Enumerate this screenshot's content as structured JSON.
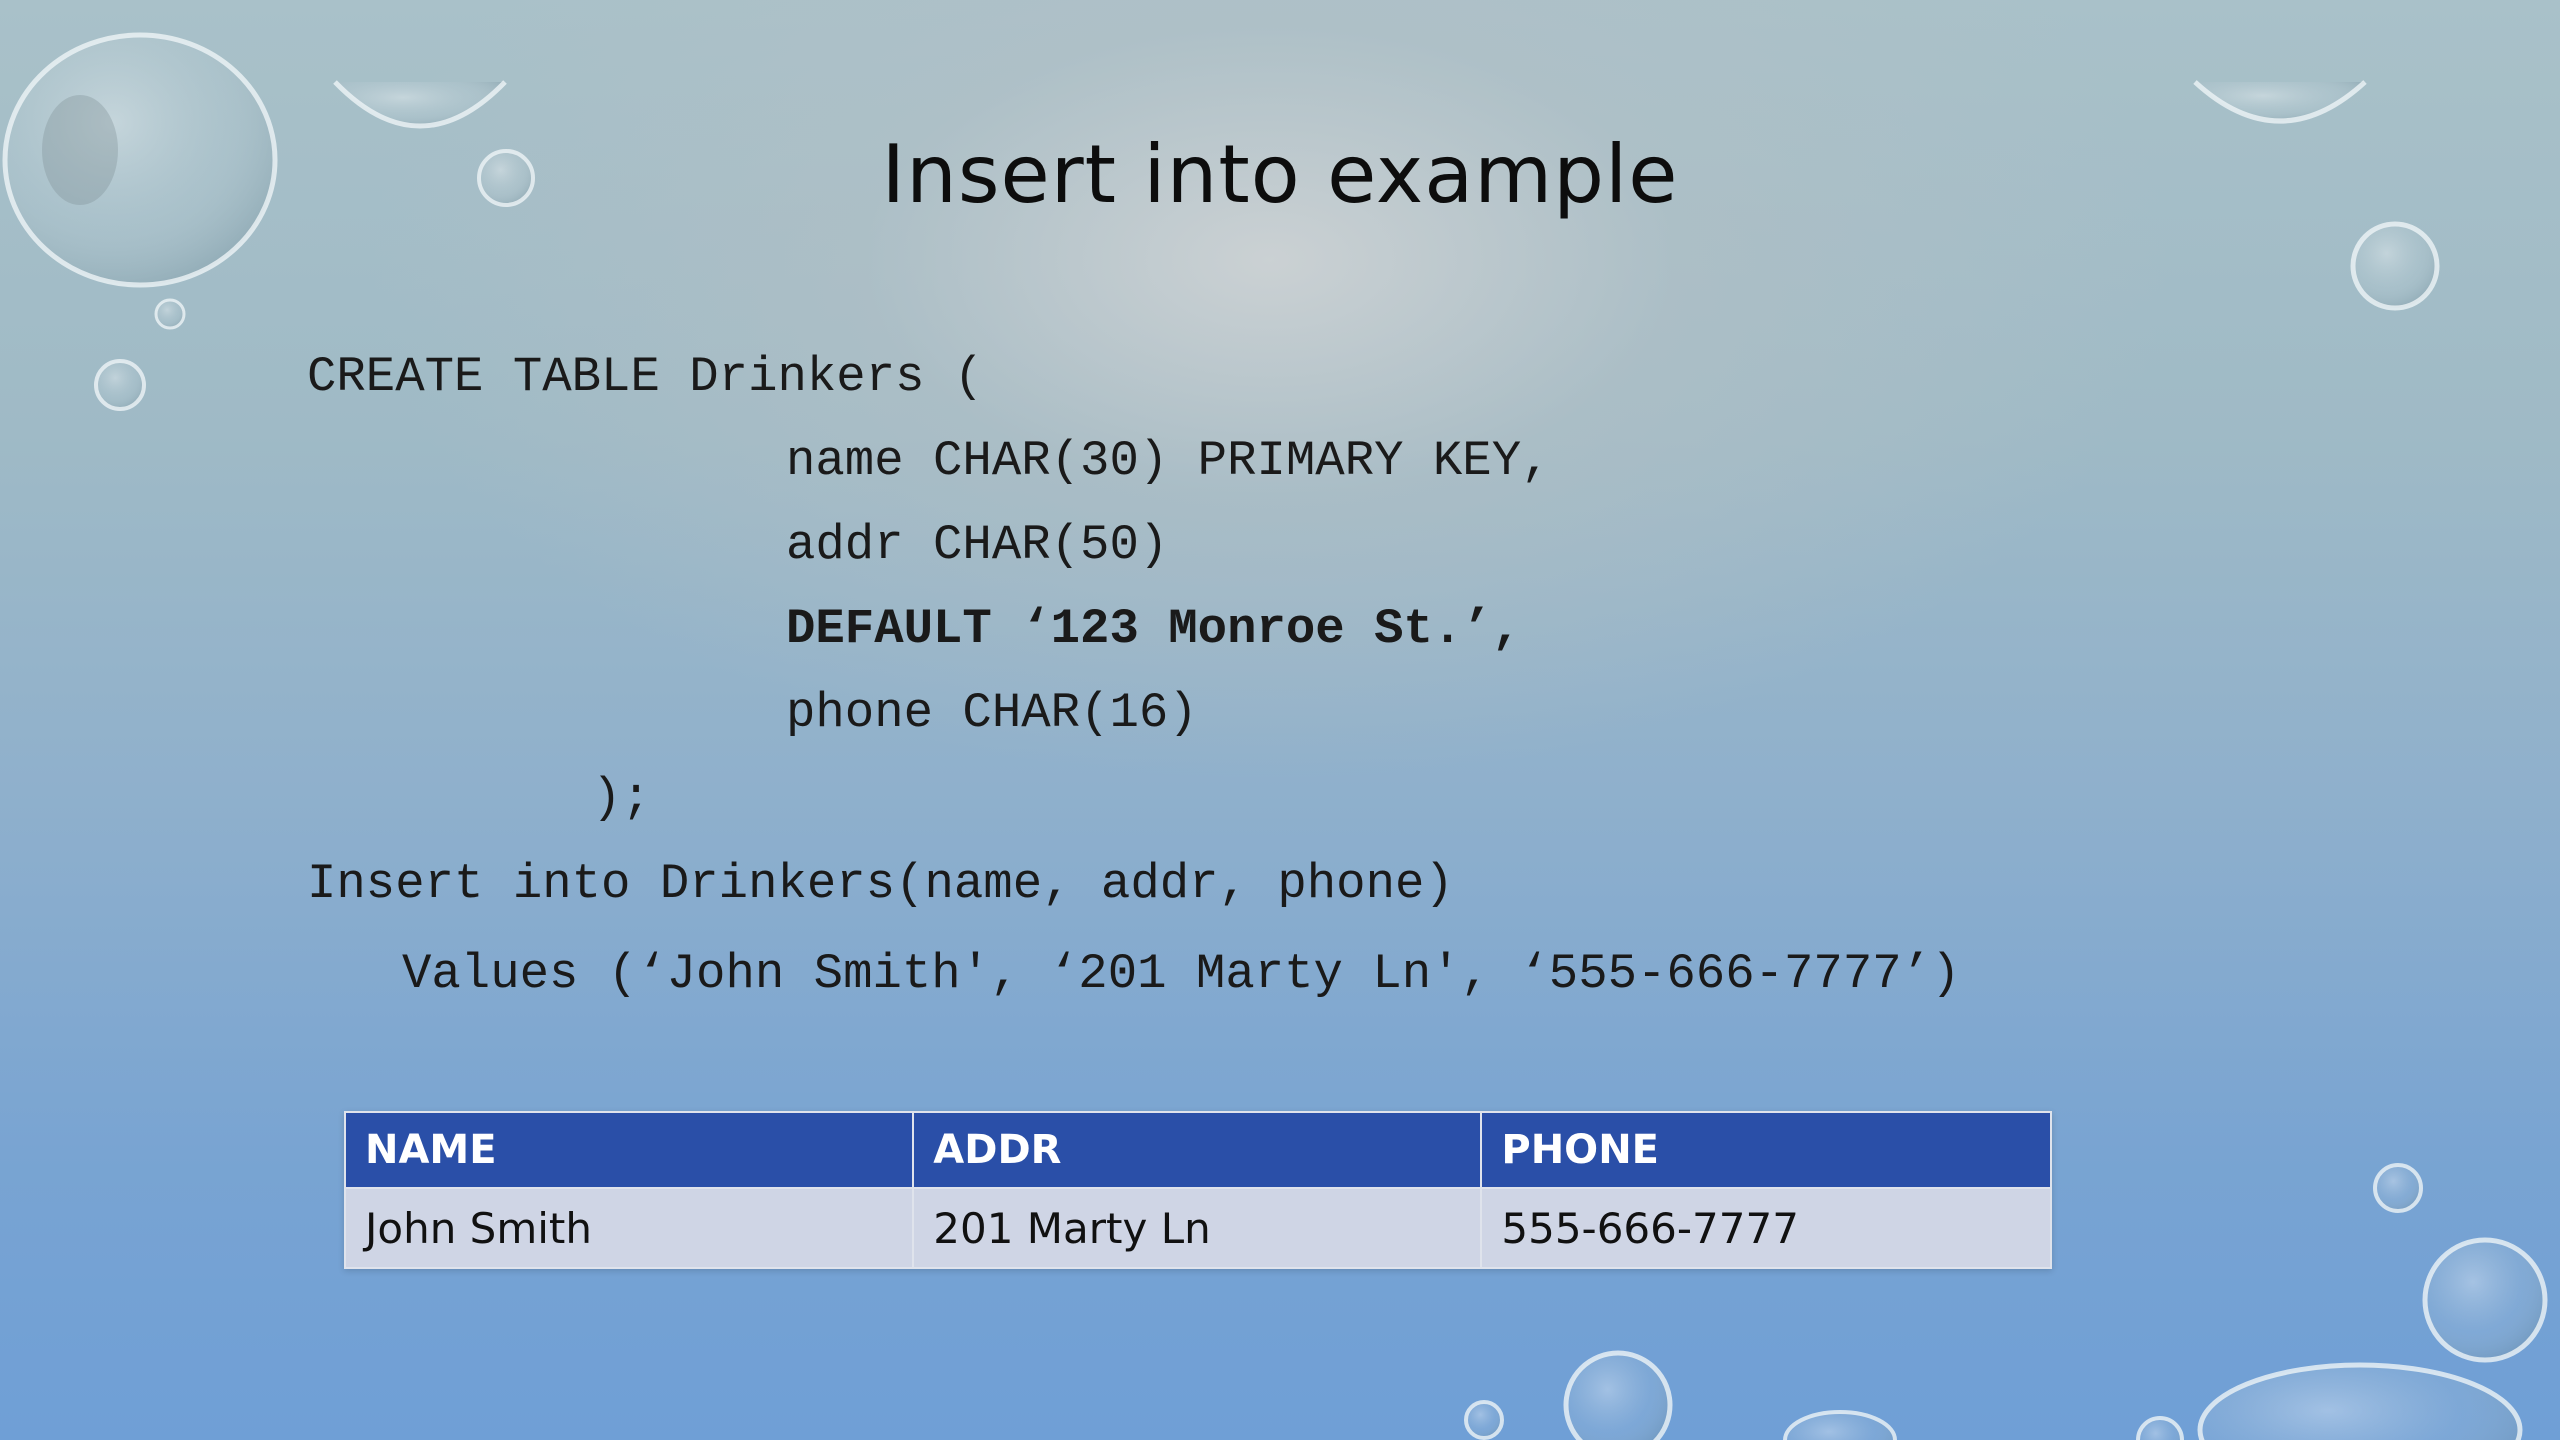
{
  "slide": {
    "title": "Insert into example",
    "code": {
      "line1": "CREATE TABLE Drinkers (",
      "line2": "name CHAR(30) PRIMARY KEY,",
      "line3": "addr CHAR(50)",
      "line4": "DEFAULT ‘123 Monroe St.’,",
      "line5": "phone CHAR(16)",
      "line6": ");",
      "line7": "Insert into Drinkers(name, addr, phone)",
      "line8": "Values (‘John Smith', ‘201 Marty Ln', ‘555-666-7777’)"
    },
    "table": {
      "headers": [
        "NAME",
        "ADDR",
        "PHONE"
      ],
      "rows": [
        [
          "John Smith",
          "201 Marty Ln",
          "555-666-7777"
        ]
      ]
    }
  },
  "colors": {
    "table_header_bg": "#2a4fa8",
    "table_row_bg": "#cfd5e5",
    "background_top": "#a9c1c9",
    "background_bottom": "#6f9fd6"
  }
}
